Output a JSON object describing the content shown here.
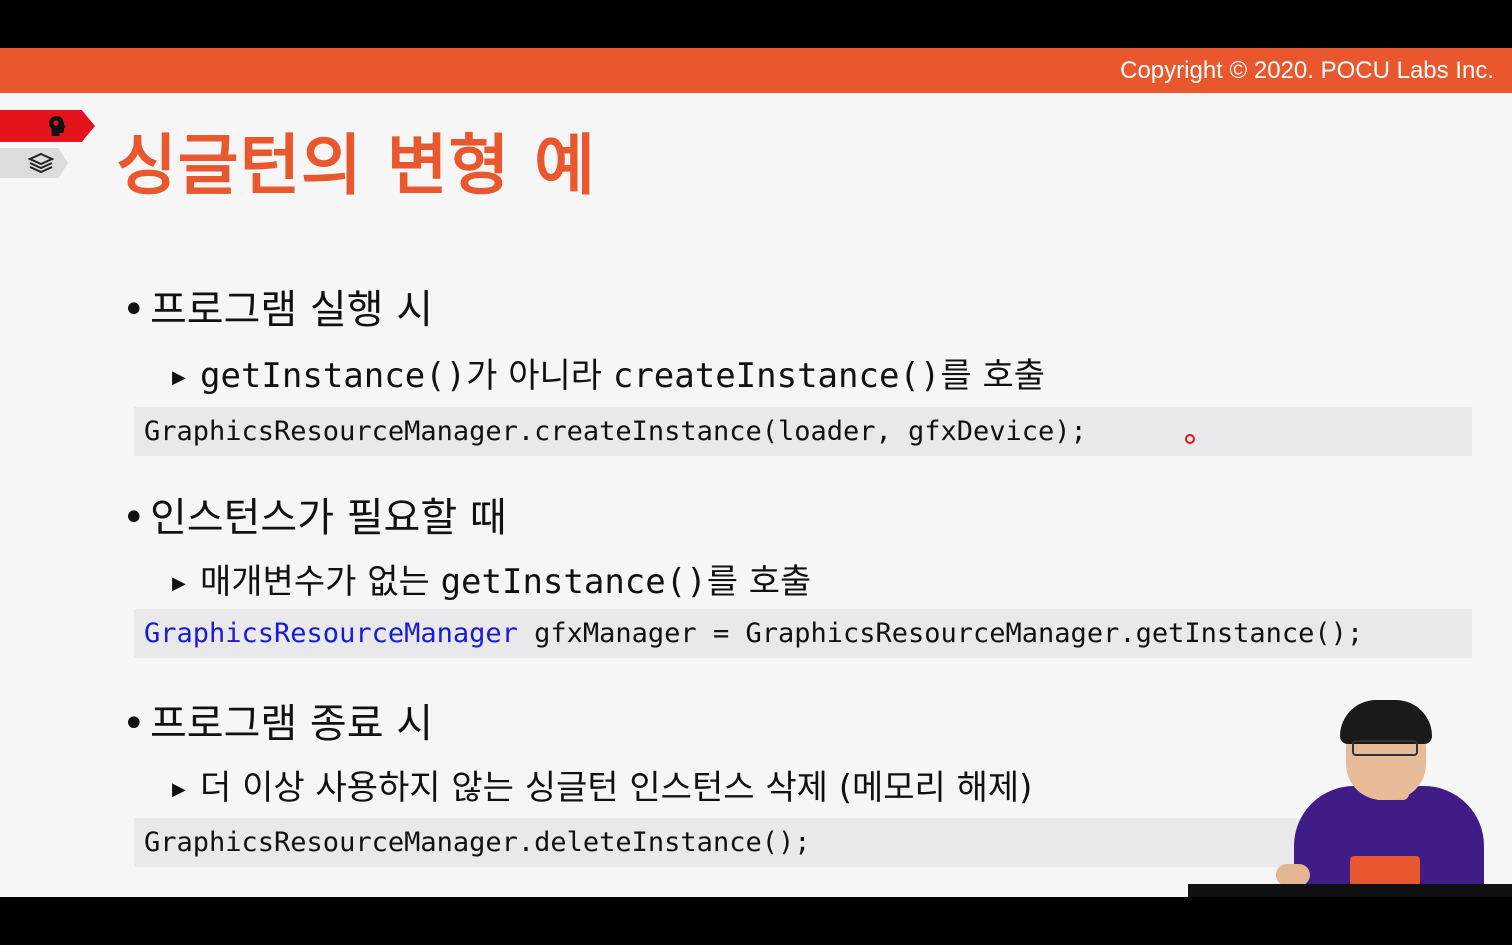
{
  "header": {
    "copyright": "Copyright © 2020. POCU Labs Inc.",
    "accent_color": "#e8572e"
  },
  "side_tabs": [
    {
      "icon": "brain-head-icon",
      "color": "#e3141b"
    },
    {
      "icon": "layers-stack-icon",
      "color": "#dcdcdc"
    }
  ],
  "slide": {
    "title": "싱글턴의 변형 예",
    "sections": [
      {
        "bullet": "프로그램 실행 시",
        "sub_code": "getInstance()",
        "sub_text_1": "가 아니라 ",
        "sub_code_2": "createInstance()",
        "sub_text_2": "를 호출",
        "code": "GraphicsResourceManager.createInstance(loader, gfxDevice);"
      },
      {
        "bullet": "인스턴스가 필요할 때",
        "sub_text_1": "매개변수가 없는 ",
        "sub_code": "getInstance()",
        "sub_text_2": "를 호출",
        "code_type": "GraphicsResourceManager",
        "code_rest": " gfxManager = GraphicsResourceManager.getInstance();"
      },
      {
        "bullet": "프로그램 종료 시",
        "sub_text_1": "더 이상 사용하지 않는 싱글턴 인스턴스 삭제 (메모리 해제)",
        "code": "GraphicsResourceManager.deleteInstance();"
      }
    ]
  }
}
